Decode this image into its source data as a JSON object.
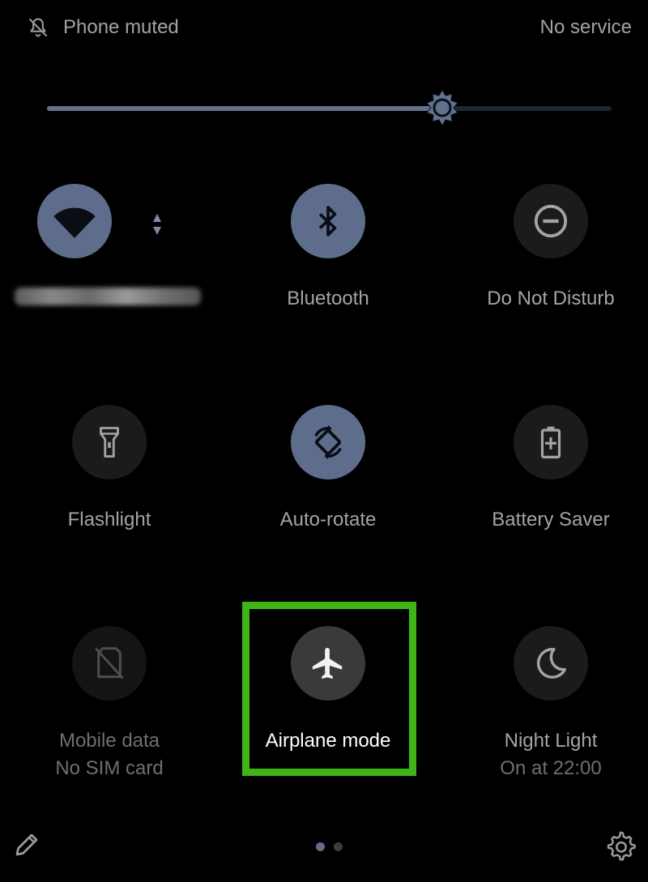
{
  "status_bar": {
    "left_icon": "bell-off-icon",
    "left_text": "Phone muted",
    "right_text": "No service"
  },
  "brightness": {
    "level": 0.7,
    "icon": "brightness-icon"
  },
  "tiles": {
    "wifi": {
      "label": "",
      "state": "on",
      "icon": "wifi-icon"
    },
    "bluetooth": {
      "label": "Bluetooth",
      "state": "on",
      "icon": "bluetooth-icon"
    },
    "dnd": {
      "label": "Do Not Disturb",
      "state": "off",
      "icon": "do-not-disturb-icon"
    },
    "flashlight": {
      "label": "Flashlight",
      "state": "off",
      "icon": "flashlight-icon"
    },
    "autorotate": {
      "label": "Auto-rotate",
      "state": "on",
      "icon": "auto-rotate-icon"
    },
    "battery_saver": {
      "label": "Battery Saver",
      "state": "off",
      "icon": "battery-saver-icon"
    },
    "mobile_data": {
      "label": "Mobile data",
      "sublabel": "No SIM card",
      "state": "unavailable",
      "icon": "mobile-data-off-icon"
    },
    "airplane": {
      "label": "Airplane mode",
      "state": "off",
      "icon": "airplane-icon"
    },
    "night_light": {
      "label": "Night Light",
      "sublabel": "On at 22:00",
      "state": "off",
      "icon": "moon-icon"
    }
  },
  "footer": {
    "edit_icon": "pencil-icon",
    "settings_icon": "gear-icon",
    "page_count": 2,
    "current_page": 1
  },
  "colors": {
    "accent": "#5e6d8c",
    "highlight": "#3fb417",
    "background": "#000000"
  }
}
